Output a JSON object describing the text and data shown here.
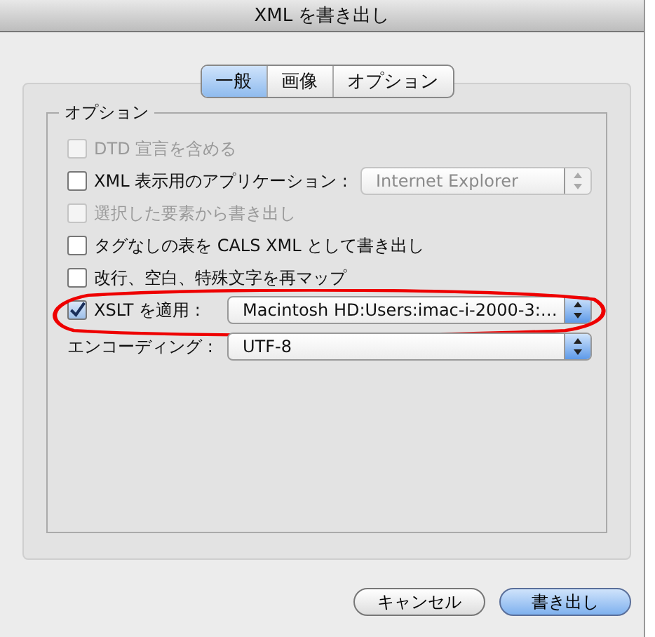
{
  "window": {
    "title": "XML を書き出し"
  },
  "tabs": [
    {
      "label": "一般",
      "selected": true
    },
    {
      "label": "画像",
      "selected": false
    },
    {
      "label": "オプション",
      "selected": false
    }
  ],
  "group": {
    "title": "オプション"
  },
  "rows": [
    {
      "kind": "checkbox",
      "label": "DTD 宣言を含める",
      "checked": false,
      "disabled": true,
      "circled": false
    },
    {
      "kind": "checkbox-select",
      "label": "XML 表示用のアプリケーション :",
      "checked": false,
      "disabled": false,
      "circled": false,
      "select": {
        "value": "Internet Explorer",
        "disabled": true
      }
    },
    {
      "kind": "checkbox",
      "label": "選択した要素から書き出し",
      "checked": false,
      "disabled": true,
      "circled": false
    },
    {
      "kind": "checkbox",
      "label": "タグなしの表を CALS XML として書き出し",
      "checked": false,
      "disabled": false,
      "circled": false
    },
    {
      "kind": "checkbox",
      "label": "改行、空白、特殊文字を再マップ",
      "checked": false,
      "disabled": false,
      "circled": false
    },
    {
      "kind": "checkbox-select",
      "label": "XSLT を適用 :",
      "checked": true,
      "disabled": false,
      "circled": true,
      "select": {
        "value": "Macintosh HD:Users:imac-i-2000-3:…",
        "disabled": false
      }
    },
    {
      "kind": "select",
      "label": "エンコーディング :",
      "circled": false,
      "select": {
        "value": "UTF-8",
        "disabled": false
      }
    }
  ],
  "buttons": [
    {
      "label": "キャンセル",
      "default": false
    },
    {
      "label": "書き出し",
      "default": true
    }
  ]
}
